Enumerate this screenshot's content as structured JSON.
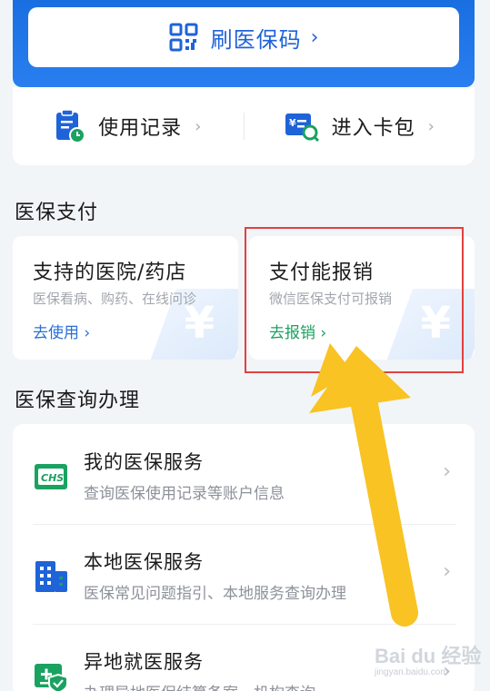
{
  "header": {
    "scan_label": "刷医保码",
    "chevron": "›",
    "scan_icon": "qr-code-icon"
  },
  "records_bar": {
    "usage_label": "使用记录",
    "card_label": "进入卡包",
    "chevron": "›"
  },
  "payment_section": {
    "title": "医保支付",
    "cards": [
      {
        "title": "支持的医院/药店",
        "subtitle": "医保看病、购药、在线问诊",
        "action": "去使用 ›",
        "action_color": "#2b6fd8"
      },
      {
        "title": "支付能报销",
        "subtitle": "微信医保支付可报销",
        "action": "去报销 ›",
        "action_color": "#1aa260"
      }
    ]
  },
  "query_section": {
    "title": "医保查询办理",
    "items": [
      {
        "title": "我的医保服务",
        "subtitle": "查询医保使用记录等账户信息",
        "icon": "chs-card-icon",
        "badge": "CHS"
      },
      {
        "title": "本地医保服务",
        "subtitle": "医保常见问题指引、本地服务查询办理",
        "icon": "building-icon"
      },
      {
        "title": "异地就医服务",
        "subtitle": "办理异地医保结算备案、机构查询",
        "icon": "medical-shield-icon"
      }
    ],
    "chevron": "›"
  },
  "watermark": {
    "main": "Bai du 经验",
    "sub": "jingyan.baidu.com"
  },
  "colors": {
    "brand_blue": "#1f63d8",
    "green": "#1aa260",
    "highlight_red": "#e14040",
    "arrow_yellow": "#f8c323"
  }
}
